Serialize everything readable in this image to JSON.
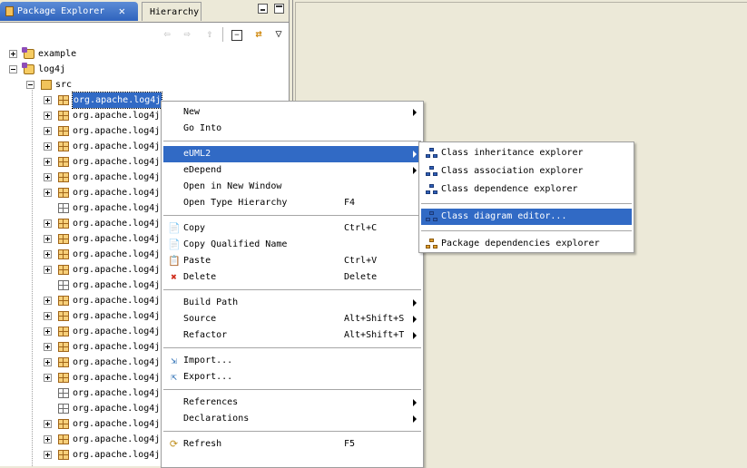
{
  "tabs": [
    {
      "label": "Package Explorer",
      "icon": "package-icon",
      "active": true,
      "close_icon": "close-icon"
    },
    {
      "label": "Hierarchy",
      "active": false
    }
  ],
  "toolbar": {
    "back_icon": "back-arrow-icon",
    "forward_icon": "forward-arrow-icon",
    "up_icon": "up-icon",
    "collapse_icon": "collapse-all-icon",
    "link_icon": "link-with-editor-icon",
    "menu_icon": "view-menu-icon"
  },
  "tree": {
    "items": [
      {
        "label": "example",
        "type": "project",
        "expander": "plus"
      },
      {
        "label": "log4j",
        "type": "project",
        "expander": "minus"
      },
      {
        "label": "src",
        "type": "source-folder",
        "expander": "minus"
      },
      {
        "label": "org.apache.log4j",
        "type": "package",
        "selected": true
      },
      {
        "label": "org.apache.log4j",
        "type": "package"
      },
      {
        "label": "org.apache.log4j",
        "type": "package"
      },
      {
        "label": "org.apache.log4j",
        "type": "package"
      },
      {
        "label": "org.apache.log4j",
        "type": "package"
      },
      {
        "label": "org.apache.log4j",
        "type": "package"
      },
      {
        "label": "org.apache.log4j",
        "type": "package"
      },
      {
        "label": "org.apache.log4j",
        "type": "package-empty"
      },
      {
        "label": "org.apache.log4j",
        "type": "package"
      },
      {
        "label": "org.apache.log4j",
        "type": "package"
      },
      {
        "label": "org.apache.log4j",
        "type": "package"
      },
      {
        "label": "org.apache.log4j",
        "type": "package"
      },
      {
        "label": "org.apache.log4j",
        "type": "package-empty"
      },
      {
        "label": "org.apache.log4j",
        "type": "package"
      },
      {
        "label": "org.apache.log4j",
        "type": "package"
      },
      {
        "label": "org.apache.log4j",
        "type": "package"
      },
      {
        "label": "org.apache.log4j",
        "type": "package"
      },
      {
        "label": "org.apache.log4j",
        "type": "package"
      },
      {
        "label": "org.apache.log4j",
        "type": "package"
      },
      {
        "label": "org.apache.log4j",
        "type": "package-empty"
      },
      {
        "label": "org.apache.log4j",
        "type": "package-empty"
      },
      {
        "label": "org.apache.log4j",
        "type": "package"
      },
      {
        "label": "org.apache.log4j",
        "type": "package"
      },
      {
        "label": "org.apache.log4j",
        "type": "package"
      }
    ]
  },
  "context_menu": {
    "items": [
      {
        "label": "New",
        "mnemonic": "w",
        "submenu": true
      },
      {
        "label": "Go Into",
        "mnemonic": "I"
      },
      {
        "sep": true
      },
      {
        "label": "eUML2",
        "submenu": true,
        "highlighted": true
      },
      {
        "label": "eDepend",
        "submenu": true
      },
      {
        "label": "Open in New Window",
        "mnemonic": "N"
      },
      {
        "label": "Open Type Hierarchy",
        "accel": "F4"
      },
      {
        "sep": true
      },
      {
        "label": "Copy",
        "accel": "Ctrl+C",
        "icon": "copy-icon"
      },
      {
        "label": "Copy Qualified Name",
        "icon": "copy-qualified-name-icon"
      },
      {
        "label": "Paste",
        "accel": "Ctrl+V",
        "icon": "paste-icon"
      },
      {
        "label": "Delete",
        "accel": "Delete",
        "icon": "delete-icon"
      },
      {
        "sep": true
      },
      {
        "label": "Build Path",
        "submenu": true
      },
      {
        "label": "Source",
        "accel": "Alt+Shift+S",
        "submenu": true
      },
      {
        "label": "Refactor",
        "accel": "Alt+Shift+T",
        "submenu": true
      },
      {
        "sep": true
      },
      {
        "label": "Import...",
        "icon": "import-icon"
      },
      {
        "label": "Export...",
        "icon": "export-icon"
      },
      {
        "sep": true
      },
      {
        "label": "References",
        "submenu": true
      },
      {
        "label": "Declarations",
        "submenu": true
      },
      {
        "sep": true
      },
      {
        "label": "Refresh",
        "accel": "F5",
        "icon": "refresh-icon"
      }
    ]
  },
  "submenu": {
    "items": [
      {
        "label": "Class inheritance explorer",
        "icon": "class-inheritance-icon"
      },
      {
        "label": "Class association explorer",
        "icon": "class-association-icon"
      },
      {
        "label": "Class dependence explorer",
        "icon": "class-dependence-icon"
      },
      {
        "sep": true
      },
      {
        "label": "Class diagram editor...",
        "icon": "class-diagram-icon",
        "highlighted": true
      },
      {
        "sep": true
      },
      {
        "label": "Package dependencies explorer",
        "icon": "package-dependencies-icon"
      }
    ]
  },
  "colors": {
    "selection": "#316ac5",
    "tab_active": "#3a6fc4",
    "chrome": "#ece9d8"
  }
}
